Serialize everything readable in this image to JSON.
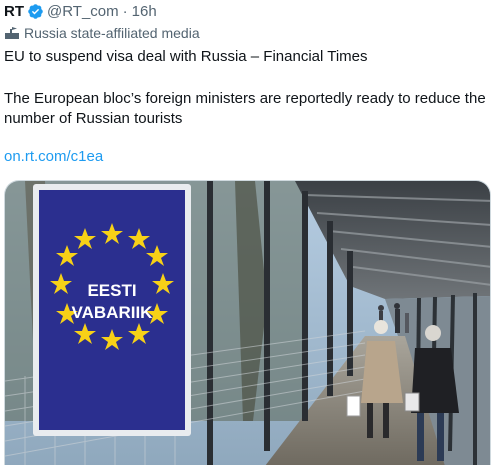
{
  "tweet": {
    "author_name": "RT",
    "handle": "@RT_com",
    "separator": "·",
    "time": "16h",
    "account_label": "Russia state-affiliated media",
    "headline": "EU to suspend visa deal with Russia – Financial Times",
    "body": "The European bloc’s foreign ministers are reportedly ready to reduce the number of Russian tourists",
    "link": "on.rt.com/c1ea"
  },
  "image": {
    "sign_line1": "EESTI",
    "sign_line2": "VABARIIK"
  },
  "colors": {
    "verified_badge": "#1d9bf0",
    "link": "#1d9bf0",
    "secondary_text": "#536471",
    "eu_blue": "#2b2f8f",
    "eu_star": "#f7d117"
  }
}
